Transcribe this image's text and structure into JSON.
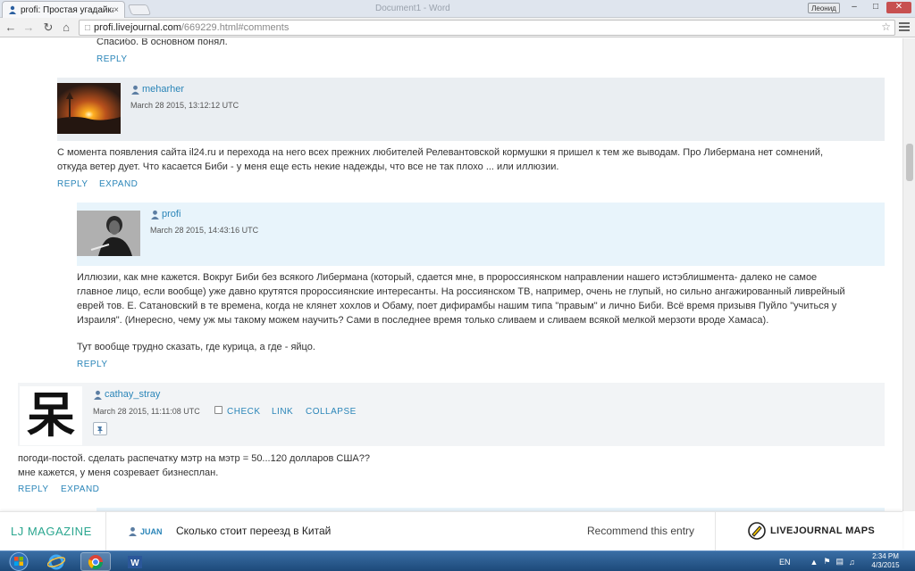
{
  "browser": {
    "tab_title": "profi: Простая угадайка",
    "tab_close": "×",
    "window_title": "Document1 - Word",
    "user_button": "Леонид",
    "win_min": "–",
    "win_max": "□",
    "win_close": "✕",
    "url_host": "profi.livejournal.com",
    "url_path": "/669229.html#comments"
  },
  "thread": {
    "top_fragment": "Спасибо. В основном понял.",
    "top_reply": "REPLY",
    "c1": {
      "user": "meharher",
      "date": "March 28 2015, 13:12:12 UTC",
      "text_lines": [
        "С момента появления сайта il24.ru и перехода на него всех прежних любителей Релевантовской кормушки я пришел к тем же выводам. Про Либермана нет сомнений,",
        "откуда ветер дует. Что касается Биби - у меня еще есть некие надежды, что все не так плохо ... или иллюзии."
      ],
      "reply": "REPLY",
      "expand": "EXPAND"
    },
    "c2": {
      "user": "profi",
      "date": "March 28 2015, 14:43:16 UTC",
      "text_lines": [
        "Иллюзии, как мне кажется. Вокруг Биби без всякого Либермана (который, сдается мне, в пророссиянском направлении нашего истэблишмента- далеко не самое",
        "главное лицо, если вообще) уже давно крутятся пророссиянские интересанты. На россиянском ТВ, например, очень не глупый, но сильно ангажированный ливрейный",
        "еврей тов. Е. Сатановский в те времена, когда не клянет хохлов и Обаму, поет дифирамбы нашим типа \"правым\" и лично Биби. Всё время призывя Пуйло \"учиться у",
        "Израиля\". (Инересно, чему уж мы такому можем научить? Сами в последнее время только сливаем и сливаем всякой мелкой мерзоти вроде Хамаса)."
      ],
      "text_tail": "Тут вообще трудно сказать, где курица, а где - яйцо.",
      "reply": "REPLY"
    },
    "c3": {
      "user": "cathay_stray",
      "date": "March 28 2015, 11:11:08 UTC",
      "check": "CHECK",
      "link": "LINK",
      "collapse": "COLLAPSE",
      "avatar_glyph": "呆",
      "text_lines": [
        "погоди-постой. сделать распечатку мэтр на мэтр = 50...120 долларов США??",
        "мне кажется, у меня созревает бизнесплан."
      ],
      "reply": "REPLY",
      "expand": "EXPAND"
    }
  },
  "ljbar": {
    "magazine": "LJ MAGAZINE",
    "author": "JUAN",
    "headline": "Сколько стоит переезд в Китай",
    "recommend": "Recommend this entry",
    "maps": "LIVEJOURNAL MAPS"
  },
  "taskbar": {
    "lang": "EN",
    "time": "2:34 PM",
    "date": "4/3/2015"
  },
  "colors": {
    "link": "#2a85b8",
    "accent_teal": "#2aa68f",
    "header_gray": "#eaeef2",
    "header_blue": "#e8f4fb"
  }
}
